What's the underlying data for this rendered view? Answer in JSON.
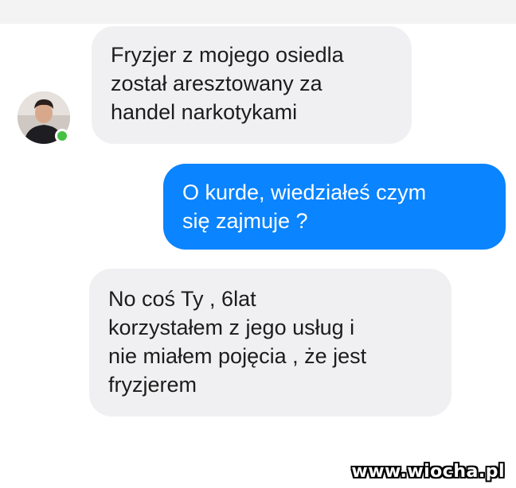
{
  "messages": [
    {
      "direction": "incoming",
      "lines": [
        "Fryzjer z mojego osiedla",
        "został aresztowany za",
        "handel narkotykami"
      ]
    },
    {
      "direction": "outgoing",
      "lines": [
        "O kurde, wiedziałeś czym",
        "się zajmuje ?"
      ]
    },
    {
      "direction": "incoming",
      "lines": [
        "No coś Ty , 6lat",
        "korzystałem z jego usług i",
        "nie miałem pojęcia , że jest",
        "fryzjerem"
      ]
    }
  ],
  "contact": {
    "online": true
  },
  "colors": {
    "outgoing_bubble": "#0a84ff",
    "incoming_bubble": "#f0f0f2",
    "online": "#44c043"
  },
  "watermark": "www.wiocha.pl"
}
